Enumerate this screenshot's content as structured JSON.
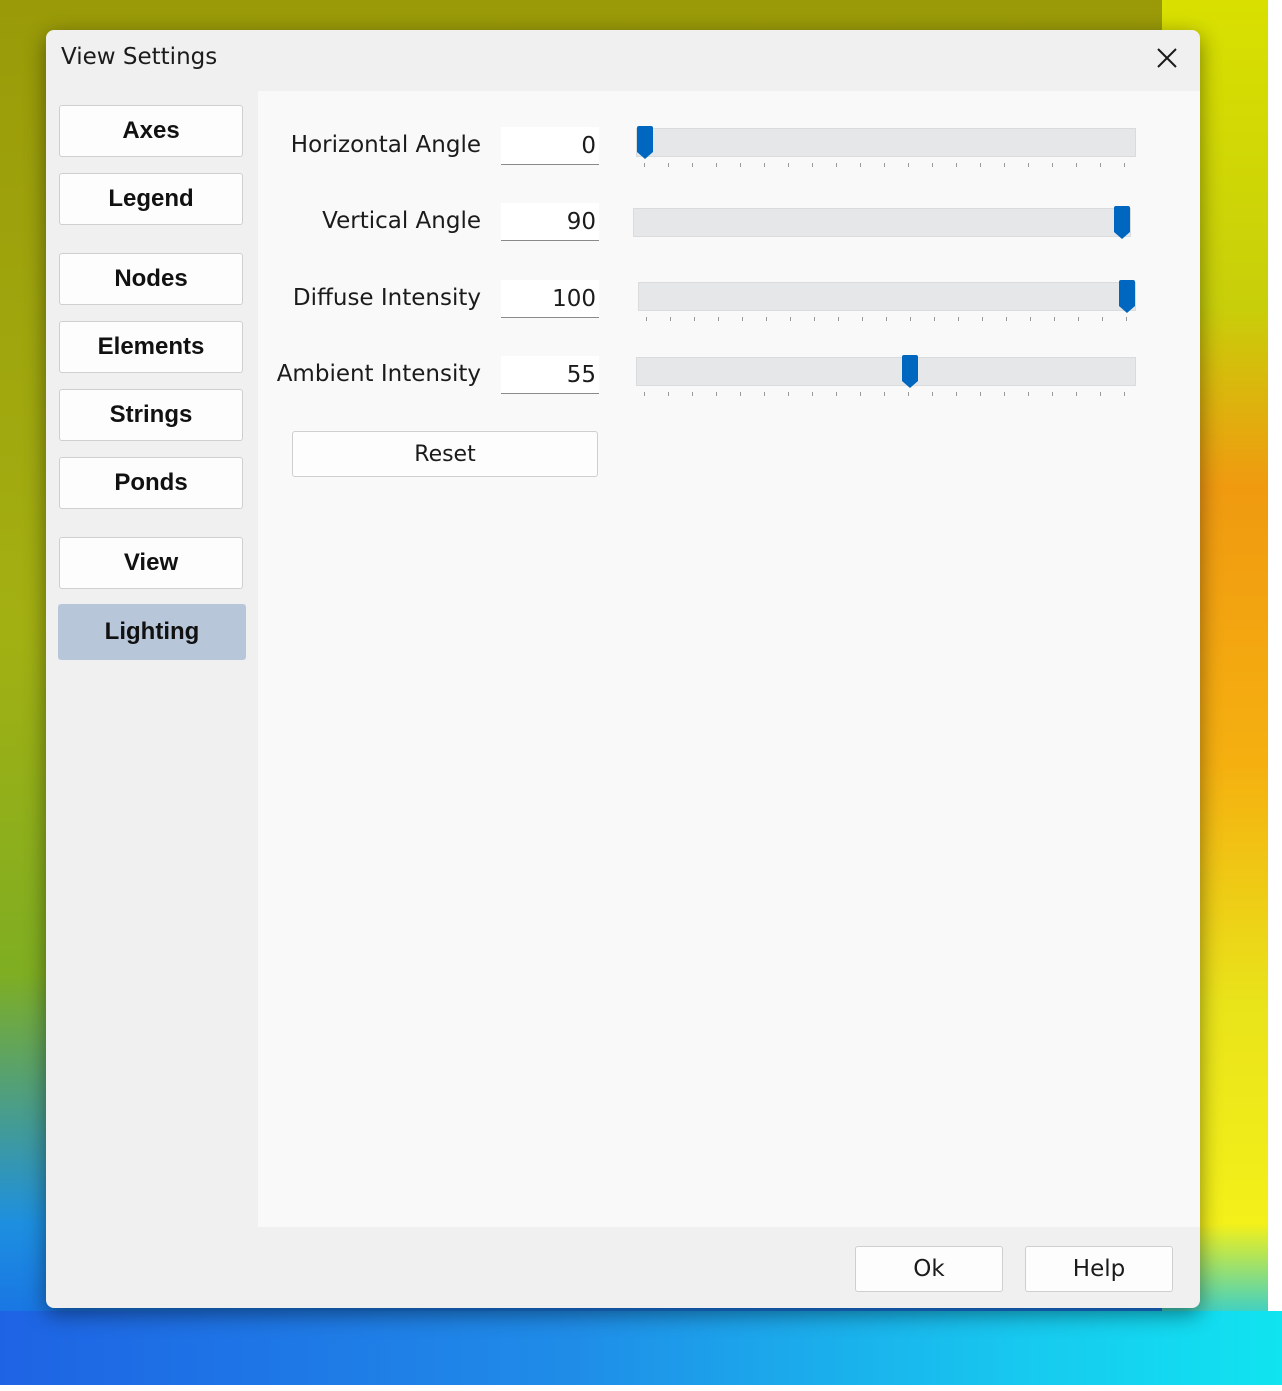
{
  "window": {
    "title": "View Settings"
  },
  "nav": {
    "items": [
      {
        "label": "Axes"
      },
      {
        "label": "Legend"
      },
      {
        "label": "Nodes"
      },
      {
        "label": "Elements"
      },
      {
        "label": "Strings"
      },
      {
        "label": "Ponds"
      },
      {
        "label": "View"
      },
      {
        "label": "Lighting",
        "selected": true
      }
    ]
  },
  "lighting": {
    "rows": [
      {
        "label": "Horizontal Angle",
        "value": "0",
        "slider_fraction": 0.0
      },
      {
        "label": "Vertical Angle",
        "value": "90",
        "slider_fraction": 1.0
      },
      {
        "label": "Diffuse Intensity",
        "value": "100",
        "slider_fraction": 1.0
      },
      {
        "label": "Ambient Intensity",
        "value": "55",
        "slider_fraction": 0.55
      }
    ],
    "reset_label": "Reset"
  },
  "footer": {
    "ok_label": "Ok",
    "help_label": "Help"
  },
  "colors": {
    "selected_nav": "#b7c7d9",
    "slider_thumb": "#0067c0",
    "track": "#e5e7e9"
  },
  "icons": {
    "close": "close-icon",
    "slider_thumb": "slider-thumb-icon"
  }
}
